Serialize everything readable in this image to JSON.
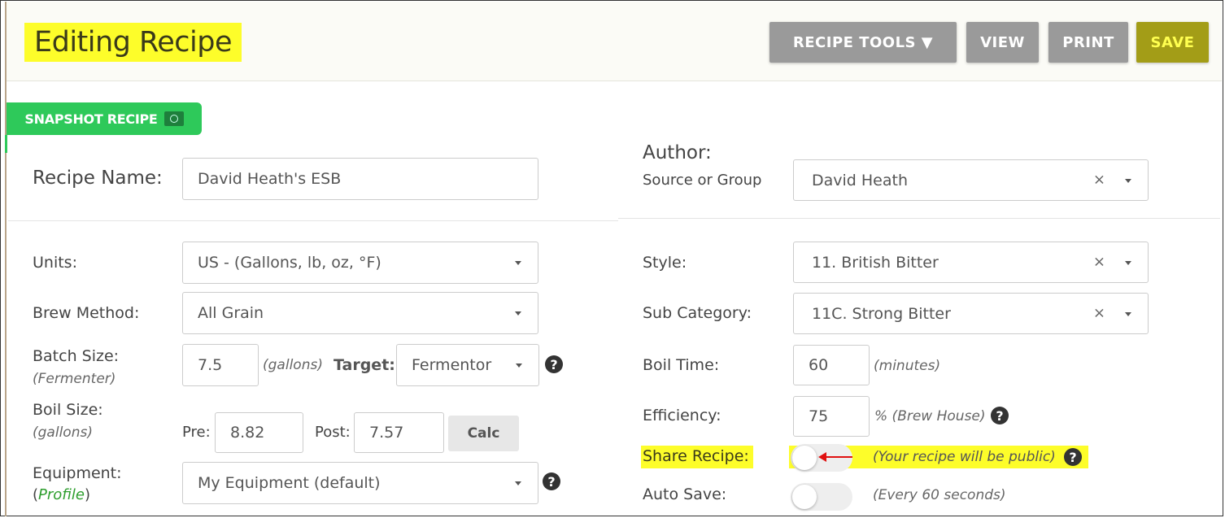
{
  "header": {
    "title": "Editing Recipe",
    "buttons": {
      "recipe_tools": "RECIPE TOOLS ▼",
      "view": "VIEW",
      "print": "PRINT",
      "save": "SAVE"
    }
  },
  "snapshot": {
    "label": "SNAPSHOT RECIPE"
  },
  "recipe_name": {
    "label": "Recipe Name:",
    "value": "David Heath's ESB"
  },
  "author": {
    "label": "Author:",
    "sublabel": "Source or Group",
    "value": "David Heath"
  },
  "units": {
    "label": "Units:",
    "value": "US - (Gallons, lb, oz, °F)"
  },
  "brew_method": {
    "label": "Brew Method:",
    "value": "All Grain"
  },
  "batch_size": {
    "label": "Batch Size:",
    "sublabel": "(Fermenter)",
    "value": "7.5",
    "unit": "(gallons)",
    "target_label": "Target:",
    "target_value": "Fermentor"
  },
  "boil_size": {
    "label": "Boil Size:",
    "sublabel": "(gallons)",
    "pre_label": "Pre:",
    "pre_value": "8.82",
    "post_label": "Post:",
    "post_value": "7.57",
    "calc": "Calc"
  },
  "equipment": {
    "label": "Equipment:",
    "open_paren": "(",
    "link": "Profile",
    "close_paren": ")",
    "value": "My Equipment (default)"
  },
  "style": {
    "label": "Style:",
    "value": "11. British Bitter"
  },
  "sub_category": {
    "label": "Sub Category:",
    "value": "11C. Strong Bitter"
  },
  "boil_time": {
    "label": "Boil Time:",
    "value": "60",
    "unit": "(minutes)"
  },
  "efficiency": {
    "label": "Efficiency:",
    "value": "75",
    "unit": "% (Brew House)"
  },
  "share_recipe": {
    "label": "Share Recipe:",
    "note": "(Your recipe will be public)",
    "enabled": false
  },
  "auto_save": {
    "label": "Auto Save:",
    "note": "(Every 60 seconds)",
    "enabled": false
  },
  "icons": {
    "help": "?",
    "clear": "×"
  },
  "colors": {
    "highlight": "#fdfd2a",
    "snapshot_green": "#2ec95a",
    "save_button": "#a39d17",
    "button_gray": "#9a9a9a"
  }
}
